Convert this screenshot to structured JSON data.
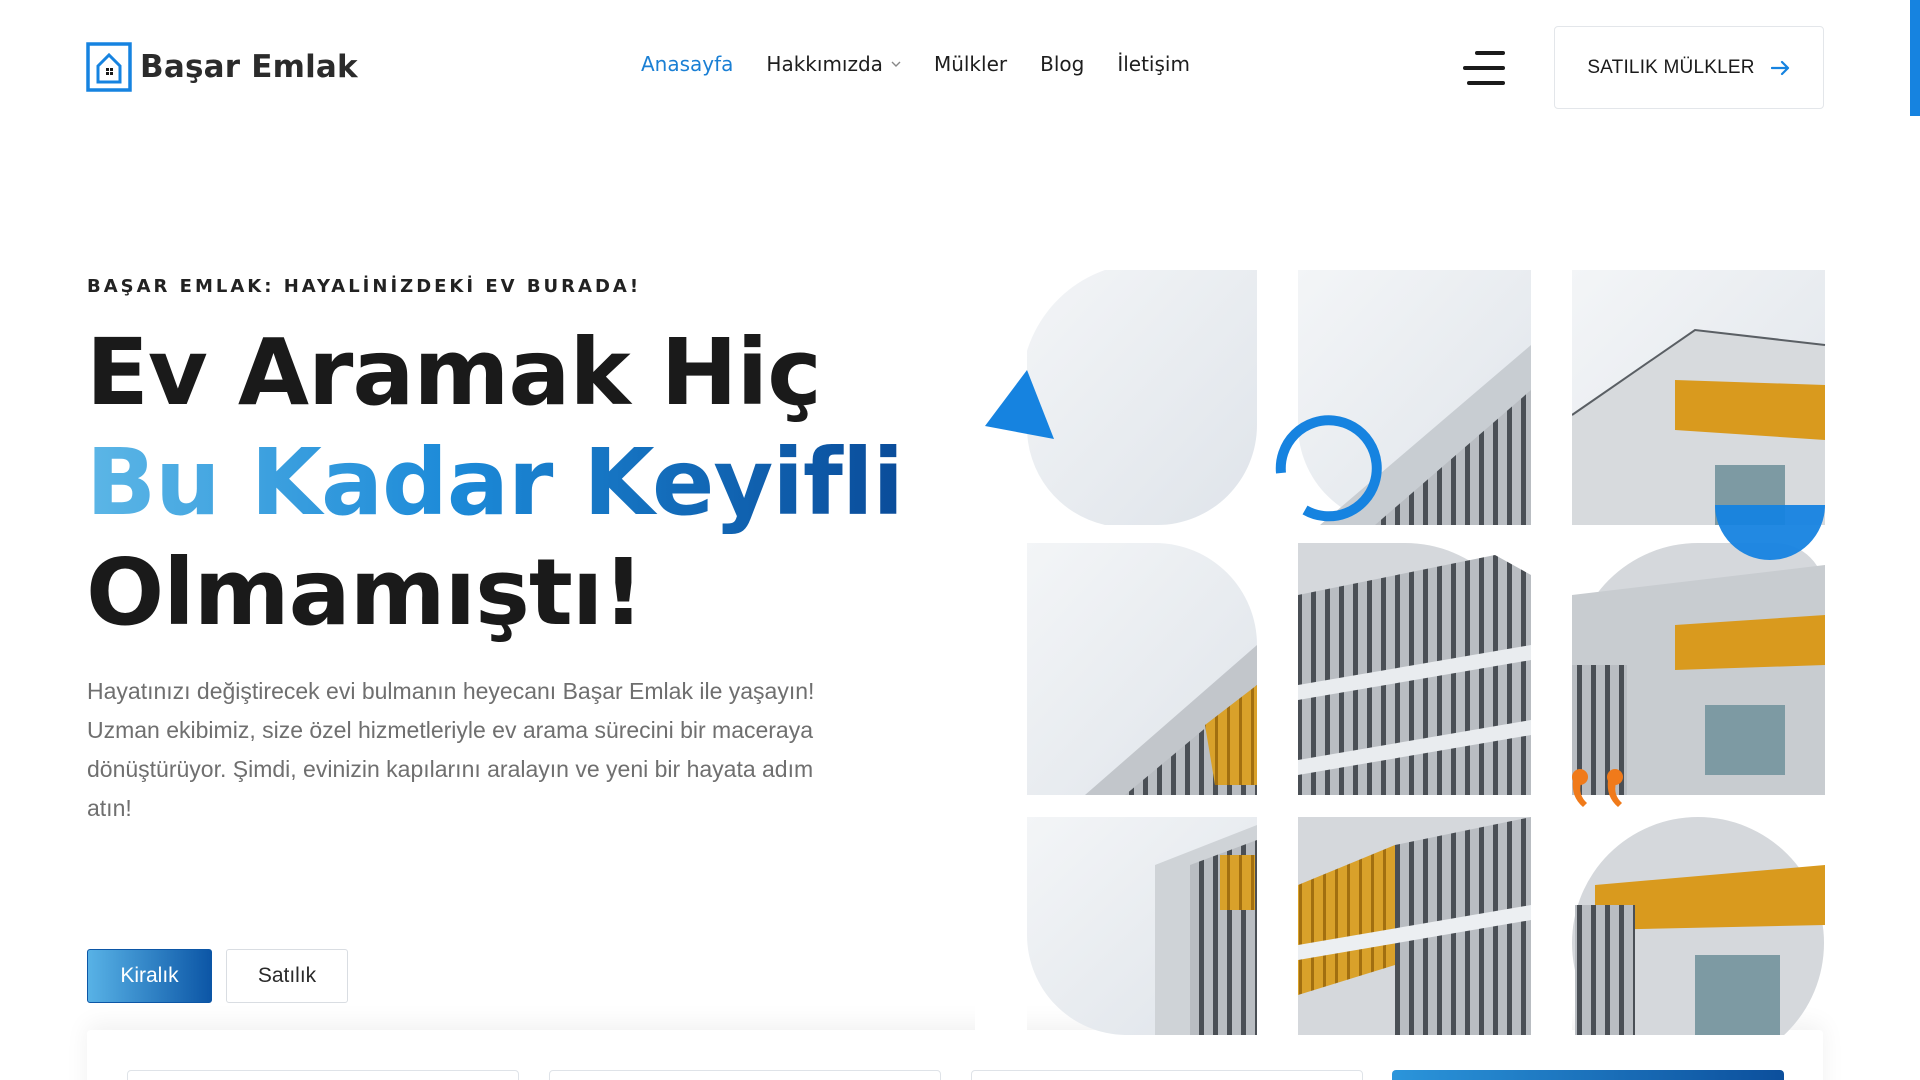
{
  "brand": {
    "name": "Başar Emlak"
  },
  "nav": {
    "items": [
      {
        "label": "Anasayfa",
        "active": true
      },
      {
        "label": "Hakkımızda",
        "dropdown": true
      },
      {
        "label": "Mülkler"
      },
      {
        "label": "Blog"
      },
      {
        "label": "İletişim"
      }
    ]
  },
  "header": {
    "cta_label": "SATILIK MÜLKLER"
  },
  "hero": {
    "tagline": "BAŞAR EMLAK: HAYALİNİZDEKİ EV BURADA!",
    "headline_line1": "Ev Aramak Hiç",
    "headline_line2": "Bu Kadar Keyifli",
    "headline_line3": "Olmamıştı!",
    "description": "Hayatınızı değiştirecek evi bulmanın heyecanı Başar Emlak ile yaşayın! Uzman ekibimiz, size özel hizmetleriyle ev arama sürecini bir maceraya dönüştürüyor. Şimdi, evinizin kapılarını aralayın ve yeni bir hayata adım atın!"
  },
  "search_tabs": [
    {
      "label": "Kiralık",
      "selected": true
    },
    {
      "label": "Satılık",
      "selected": false
    }
  ],
  "colors": {
    "accent": "#1683e0",
    "gradient_start": "#5cb6e6",
    "gradient_end": "#0a4c9a",
    "decor_orange": "#f07a1a"
  }
}
